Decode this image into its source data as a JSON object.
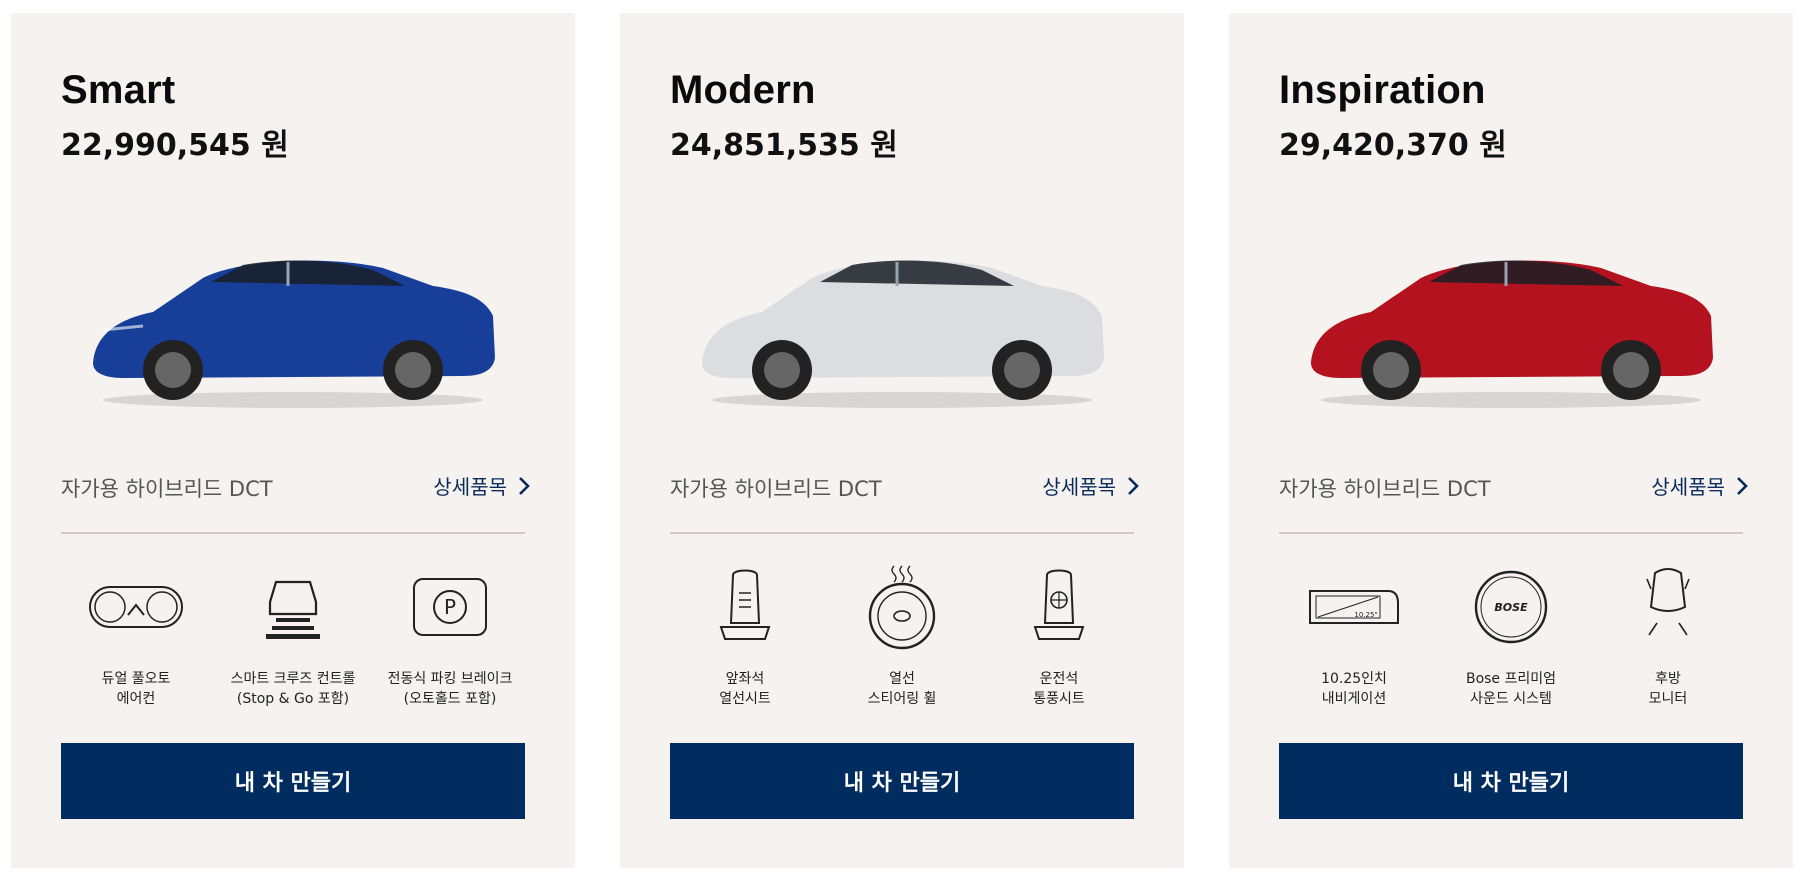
{
  "cards": [
    {
      "name": "Smart",
      "price": "22,990,545 원",
      "car_color": "#173f9a",
      "trim": "자가용 하이브리드 DCT",
      "detail_label": "상세품목",
      "features": [
        {
          "icon": "dual-auto-aircon-icon",
          "line1": "듀얼 풀오토",
          "line2": "에어컨"
        },
        {
          "icon": "smart-cruise-control-icon",
          "line1": "스마트 크루즈 컨트롤",
          "line2": "(Stop & Go 포함)"
        },
        {
          "icon": "electronic-parking-brake-icon",
          "line1": "전동식 파킹 브레이크",
          "line2": "(오토홀드 포함)"
        }
      ],
      "button_label": "내 차 만들기"
    },
    {
      "name": "Modern",
      "price": "24,851,535 원",
      "car_color": "#dcdde0",
      "trim": "자가용 하이브리드 DCT",
      "detail_label": "상세품목",
      "features": [
        {
          "icon": "heated-front-seat-icon",
          "line1": "앞좌석",
          "line2": "열선시트"
        },
        {
          "icon": "heated-steering-wheel-icon",
          "line1": "열선",
          "line2": "스티어링 휠"
        },
        {
          "icon": "ventilated-seat-icon",
          "line1": "운전석",
          "line2": "통풍시트"
        }
      ],
      "button_label": "내 차 만들기"
    },
    {
      "name": "Inspiration",
      "price": "29,420,370 원",
      "car_color": "#b3121e",
      "trim": "자가용 하이브리드 DCT",
      "detail_label": "상세품목",
      "features": [
        {
          "icon": "navigation-screen-icon",
          "line1": "10.25인치",
          "line2": "내비게이션",
          "screen_text": "10.25\""
        },
        {
          "icon": "bose-speaker-icon",
          "line1": "Bose 프리미엄",
          "line2": "사운드 시스템",
          "logo_text": "BOSE"
        },
        {
          "icon": "rear-monitor-icon",
          "line1": "후방",
          "line2": "모니터"
        }
      ],
      "button_label": "내 차 만들기"
    }
  ]
}
